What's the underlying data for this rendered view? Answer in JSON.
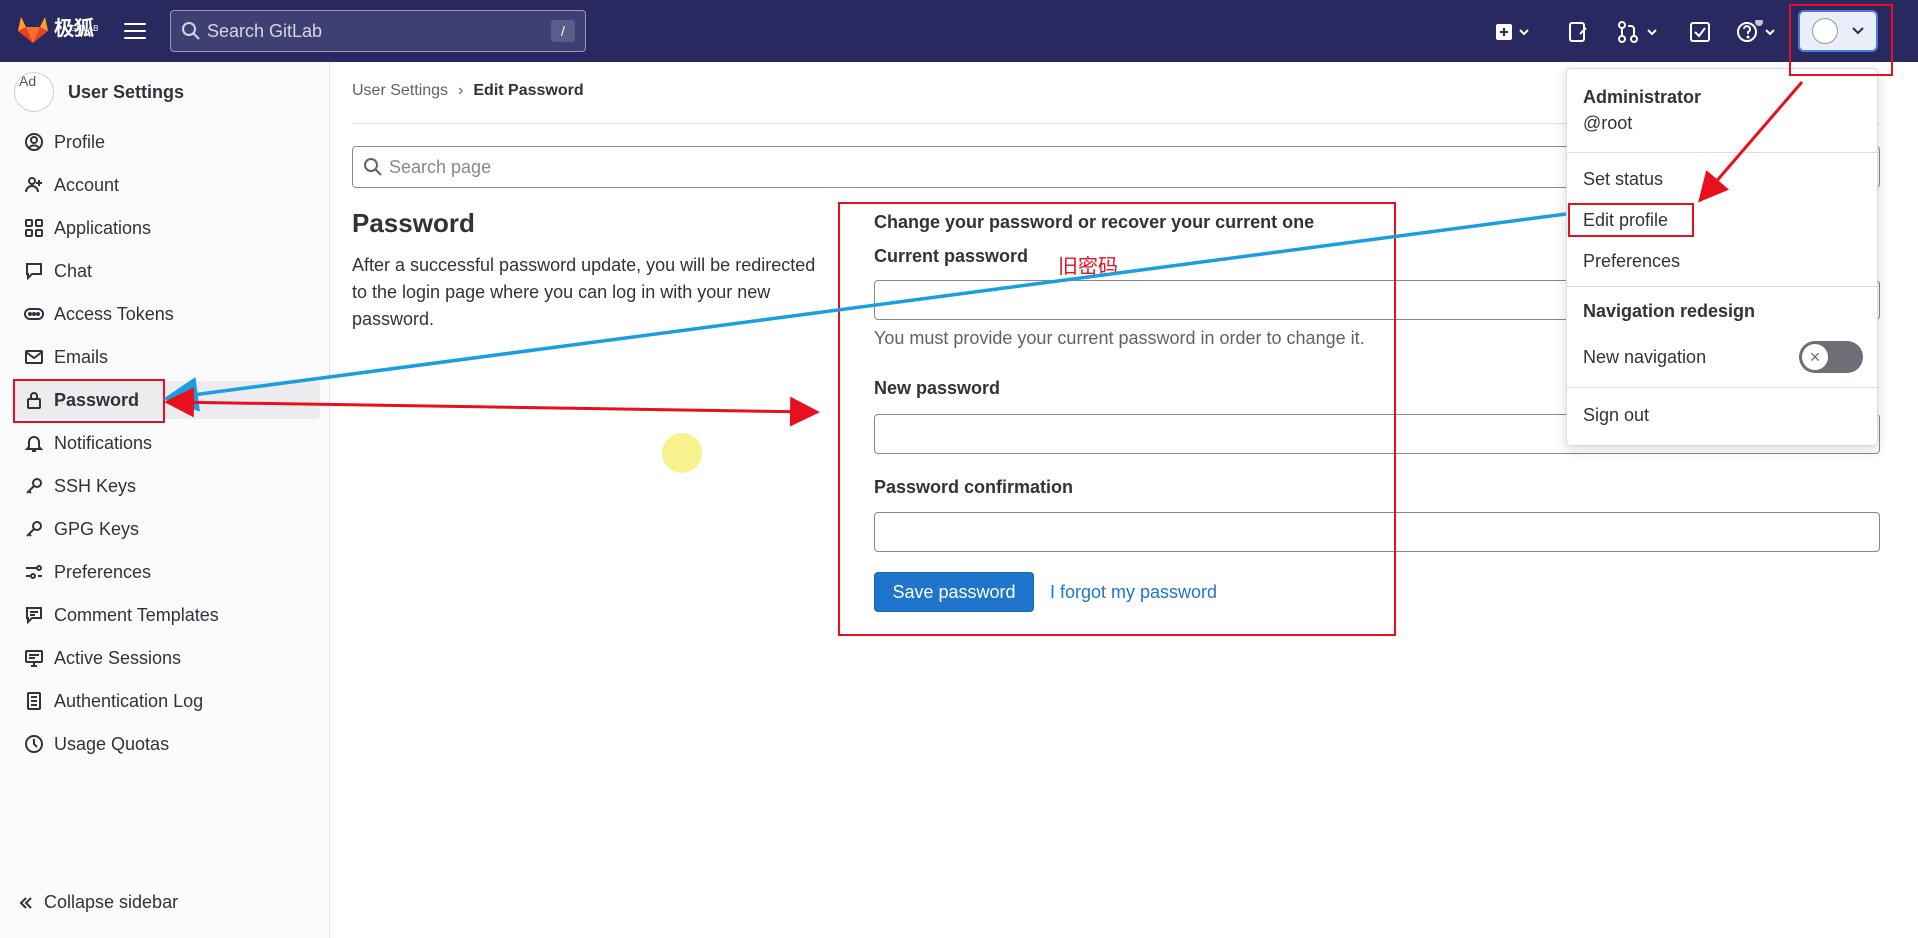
{
  "topbar": {
    "logo_text": "极狐",
    "logo_sub": "GITLAB",
    "search_placeholder": "Search GitLab",
    "search_shortcut": "/"
  },
  "sidebar": {
    "title": "User Settings",
    "avatar_alt": "Ad",
    "items": [
      {
        "label": "Profile",
        "icon": "profile-icon"
      },
      {
        "label": "Account",
        "icon": "account-icon"
      },
      {
        "label": "Applications",
        "icon": "applications-icon"
      },
      {
        "label": "Chat",
        "icon": "chat-icon"
      },
      {
        "label": "Access Tokens",
        "icon": "token-icon"
      },
      {
        "label": "Emails",
        "icon": "email-icon"
      },
      {
        "label": "Password",
        "icon": "lock-icon"
      },
      {
        "label": "Notifications",
        "icon": "bell-icon"
      },
      {
        "label": "SSH Keys",
        "icon": "key-icon"
      },
      {
        "label": "GPG Keys",
        "icon": "key-icon"
      },
      {
        "label": "Preferences",
        "icon": "preferences-icon"
      },
      {
        "label": "Comment Templates",
        "icon": "comment-icon"
      },
      {
        "label": "Active Sessions",
        "icon": "monitor-icon"
      },
      {
        "label": "Authentication Log",
        "icon": "log-icon"
      },
      {
        "label": "Usage Quotas",
        "icon": "quota-icon"
      }
    ],
    "collapse_label": "Collapse sidebar"
  },
  "breadcrumb": {
    "parent": "User Settings",
    "separator": "›",
    "current": "Edit Password"
  },
  "page_search_placeholder": "Search page",
  "section": {
    "title": "Password",
    "description": "After a successful password update, you will be redirected to the login page where you can log in with your new password."
  },
  "form": {
    "heading": "Change your password or recover your current one",
    "current_label": "Current password",
    "current_hint": "You must provide your current password in order to change it.",
    "new_label": "New password",
    "confirm_label": "Password confirmation",
    "save_label": "Save password",
    "forgot_label": "I forgot my password"
  },
  "annotation": {
    "old_password_note": "旧密码"
  },
  "user_menu": {
    "name": "Administrator",
    "username": "@root",
    "set_status": "Set status",
    "edit_profile": "Edit profile",
    "preferences": "Preferences",
    "nav_redesign_heading": "Navigation redesign",
    "new_navigation": "New navigation",
    "new_navigation_enabled": false,
    "sign_out": "Sign out"
  },
  "colors": {
    "topbar": "#292961",
    "accent": "#1f75cb",
    "annotation_red": "#e8101e",
    "annotation_blue": "#1a9ee0"
  }
}
